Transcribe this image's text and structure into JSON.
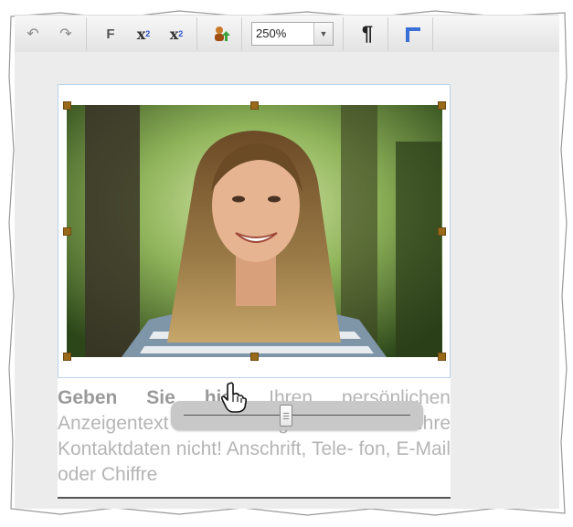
{
  "toolbar": {
    "buttons": [
      {
        "name": "undo",
        "icon": "undo-icon"
      },
      {
        "name": "redo",
        "icon": "redo-icon"
      },
      {
        "name": "bold",
        "label": "F"
      },
      {
        "name": "superscript",
        "label": "x",
        "sub": "2"
      },
      {
        "name": "subscript",
        "label": "x",
        "sub": "2"
      },
      {
        "name": "user-upload",
        "icon": "user-upload-icon"
      },
      {
        "name": "paragraph",
        "label": "¶"
      },
      {
        "name": "tabulator",
        "icon": "tab-stop-icon"
      }
    ],
    "zoom": {
      "value": "250%"
    }
  },
  "ad": {
    "bold_start": "Geben Sie hier",
    "text": " Ihren persönlichen Anzeigentext ein. Vergessen Sie Ihre Kontaktdaten nicht! Anschrift, Tele- fon, E-Mail oder Chiffre"
  },
  "slider": {
    "value": 0.45
  },
  "colors": {
    "selection_handle": "#9a6a1b",
    "toolbar_bg": "#ececec",
    "text_gray": "#b5b5b5"
  }
}
